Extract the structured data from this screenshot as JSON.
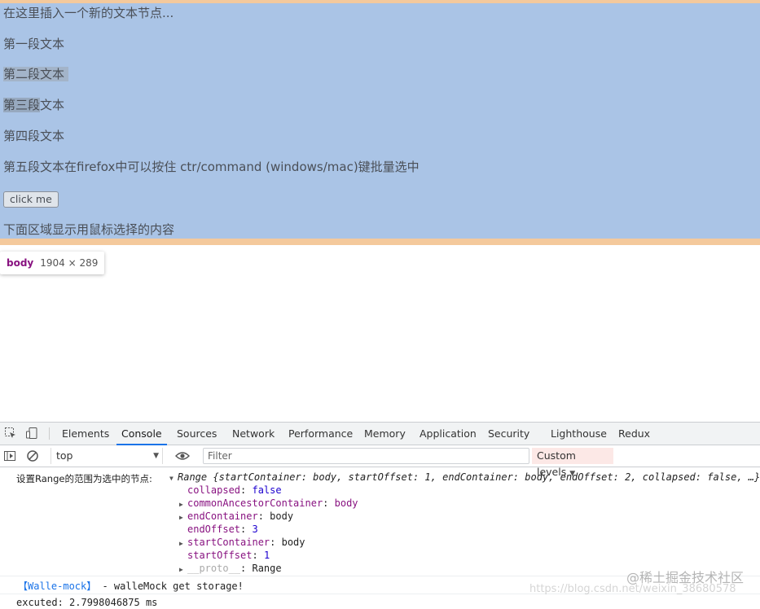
{
  "page": {
    "lines": [
      "在这里插入一个新的文本节点...",
      "第一段文本",
      "第二段文本",
      "第三段",
      "文本",
      "第四段文本",
      "第五段文本在firefox中可以按住 ctr/command (windows/mac)键批量选中",
      "下面区域显示用鼠标选择的内容"
    ],
    "button_label": "click me"
  },
  "tooltip": {
    "tag": "body",
    "dims": "1904 × 289"
  },
  "devtools": {
    "tabs": [
      "Elements",
      "Console",
      "Sources",
      "Network",
      "Performance",
      "Memory",
      "Application",
      "Security",
      "Lighthouse",
      "Redux"
    ],
    "active_tab": "Console",
    "context": "top",
    "filter_placeholder": "Filter",
    "levels": "Custom levels",
    "console": {
      "label": "设置Range的范围为选中的节点:",
      "summary": "Range {startContainer: body, startOffset: 1, endContainer: body, endOffset: 2, collapsed: false, …}",
      "props": [
        {
          "key": "collapsed",
          "value": "false",
          "expandable": false
        },
        {
          "key": "commonAncestorContainer",
          "value": "body",
          "expandable": true
        },
        {
          "key": "endContainer",
          "value": "body",
          "expandable": true
        },
        {
          "key": "endOffset",
          "value": "3",
          "expandable": false
        },
        {
          "key": "startContainer",
          "value": "body",
          "expandable": true
        },
        {
          "key": "startOffset",
          "value": "1",
          "expandable": false
        },
        {
          "key": "__proto__",
          "value": "Range",
          "expandable": true
        }
      ],
      "walle_prefix": "【Walle-mock】",
      "walle_text": " - walleMock get storage!",
      "last_line": "excuted: 2.7998046875 ms"
    },
    "watermark": "@稀土掘金技术社区",
    "watermark_url": "https://blog.csdn.net/weixin_38680578"
  }
}
